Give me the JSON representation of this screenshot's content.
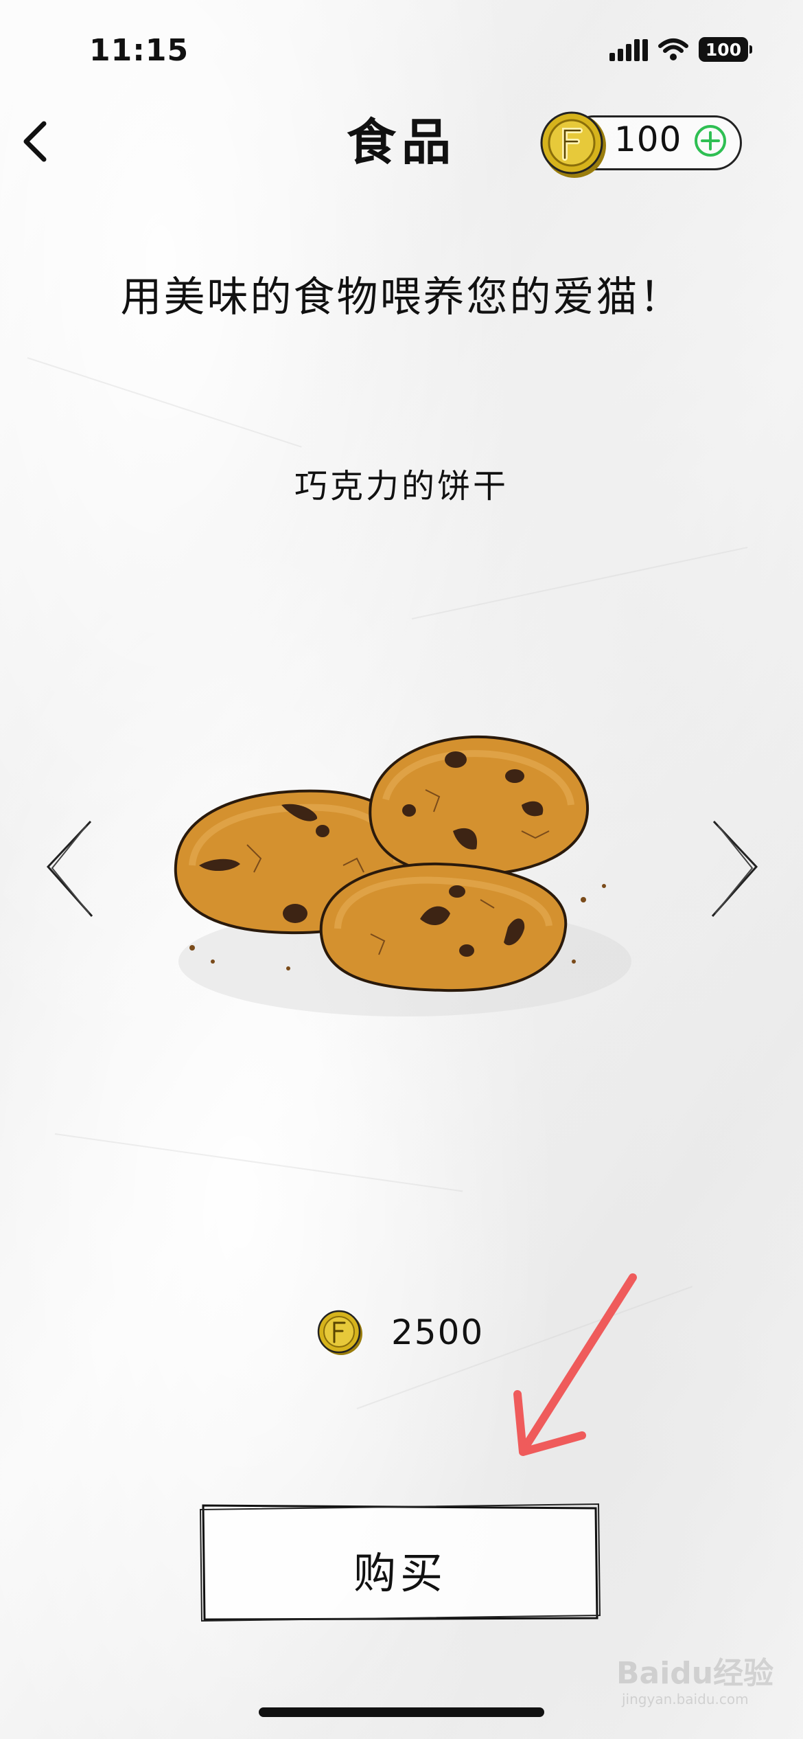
{
  "status_bar": {
    "time": "11:15",
    "battery": "100",
    "icons": [
      "cellular-signal-icon",
      "wifi-icon",
      "battery-icon"
    ]
  },
  "nav": {
    "back_icon": "chevron-left-icon",
    "title": "食品",
    "balance": "100",
    "coin_icon": "coin-icon",
    "add_icon": "plus-circle-icon"
  },
  "subtitle": "用美味的食物喂养您的爱猫！",
  "item": {
    "name": "巧克力的饼干",
    "image": "chocolate-cookies",
    "price": "2500",
    "prev_icon": "chevron-left-icon",
    "next_icon": "chevron-right-icon"
  },
  "annotation": {
    "arrow_color": "#ef5b5b"
  },
  "buy": {
    "label": "购买"
  },
  "watermark": {
    "text": "Baidu经验",
    "url": "jingyan.baidu.com"
  },
  "colors": {
    "coin_gold": "#d6b31c",
    "plus_green": "#2fbf53",
    "cookie": "#d4912f",
    "chocolate": "#3d2414"
  }
}
